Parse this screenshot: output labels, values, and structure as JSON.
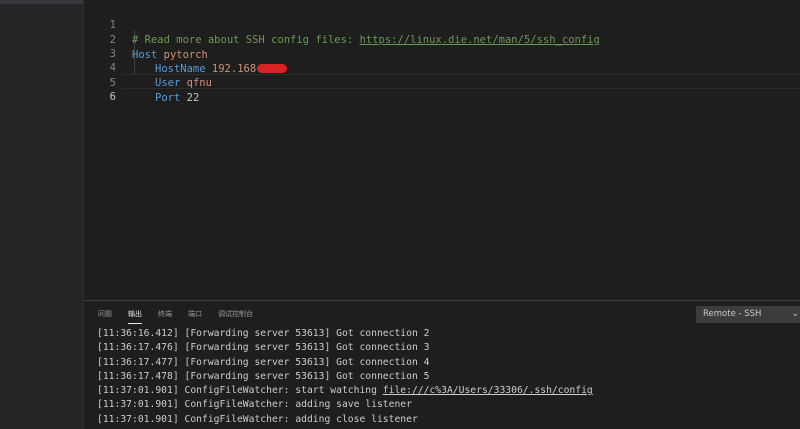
{
  "editor": {
    "lines": [
      {
        "number": "1",
        "comment": "# Read more about SSH config files: ",
        "link": "https://linux.die.net/man/5/ssh_config"
      },
      {
        "number": "2",
        "keyword": "Host",
        "value": "pytorch"
      },
      {
        "number": "3",
        "keyword": "HostName",
        "value": "192.168"
      },
      {
        "number": "4",
        "keyword": "User",
        "value": "qfnu"
      },
      {
        "number": "5",
        "keyword": "Port",
        "value": "22"
      },
      {
        "number": "6"
      }
    ]
  },
  "panel": {
    "tabs": [
      "问题",
      "输出",
      "终端",
      "端口",
      "调试控制台"
    ],
    "active_tab": "输出",
    "channel_select": "Remote - SSH",
    "output_lines": [
      "[11:36:16.412] [Forwarding server 53613] Got connection 2",
      "[11:36:17.476] [Forwarding server 53613] Got connection 3",
      "[11:36:17.477] [Forwarding server 53613] Got connection 4",
      "[11:36:17.478] [Forwarding server 53613] Got connection 5",
      {
        "prefix": "[11:37:01.901] ConfigFileWatcher: start watching ",
        "link": "file:///c%3A/Users/33306/.ssh/config"
      },
      "[11:37:01.901] ConfigFileWatcher: adding save listener",
      "[11:37:01.901] ConfigFileWatcher: adding close listener"
    ]
  },
  "colors": {
    "background": "#1e1e1e",
    "comment": "#6a9955",
    "keyword": "#569cd6",
    "string": "#ce9178",
    "number": "#b5cea8",
    "redaction": "#d92323"
  }
}
